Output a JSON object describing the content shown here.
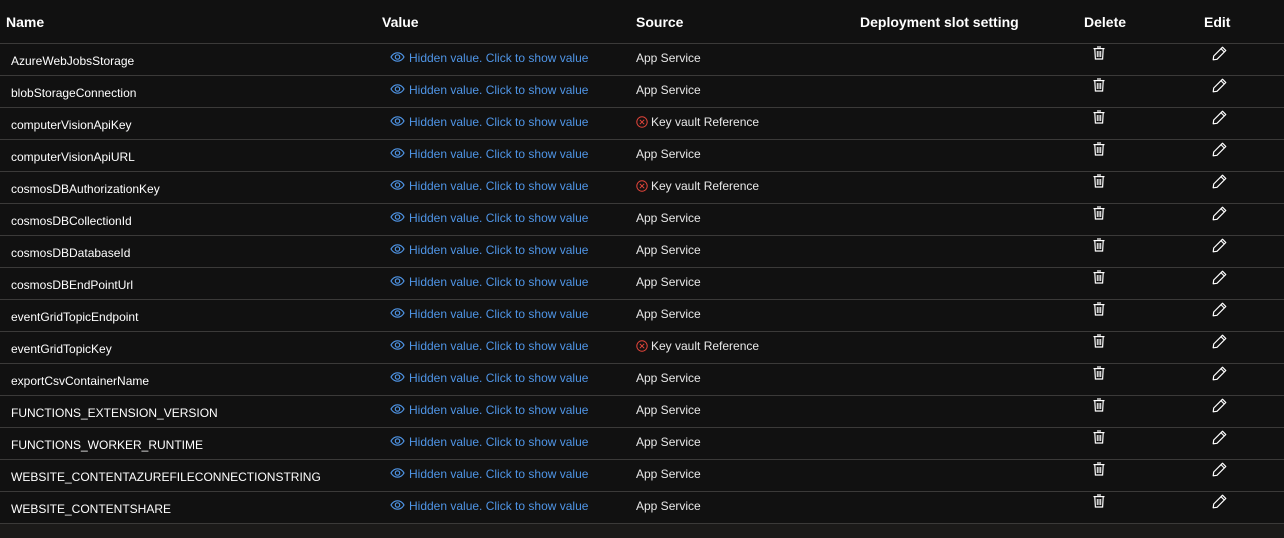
{
  "columns": {
    "name": "Name",
    "value": "Value",
    "source": "Source",
    "slot": "Deployment slot setting",
    "delete": "Delete",
    "edit": "Edit"
  },
  "rows": [
    {
      "name": "AzureWebJobsStorage",
      "value": "Hidden value. Click to show value",
      "source": "App Service",
      "source_error": false
    },
    {
      "name": "blobStorageConnection",
      "value": "Hidden value. Click to show value",
      "source": "App Service",
      "source_error": false
    },
    {
      "name": "computerVisionApiKey",
      "value": "Hidden value. Click to show value",
      "source": "Key vault Reference",
      "source_error": true
    },
    {
      "name": "computerVisionApiURL",
      "value": "Hidden value. Click to show value",
      "source": "App Service",
      "source_error": false
    },
    {
      "name": "cosmosDBAuthorizationKey",
      "value": "Hidden value. Click to show value",
      "source": "Key vault Reference",
      "source_error": true
    },
    {
      "name": "cosmosDBCollectionId",
      "value": "Hidden value. Click to show value",
      "source": "App Service",
      "source_error": false
    },
    {
      "name": "cosmosDBDatabaseId",
      "value": "Hidden value. Click to show value",
      "source": "App Service",
      "source_error": false
    },
    {
      "name": "cosmosDBEndPointUrl",
      "value": "Hidden value. Click to show value",
      "source": "App Service",
      "source_error": false
    },
    {
      "name": "eventGridTopicEndpoint",
      "value": "Hidden value. Click to show value",
      "source": "App Service",
      "source_error": false
    },
    {
      "name": "eventGridTopicKey",
      "value": "Hidden value. Click to show value",
      "source": "Key vault Reference",
      "source_error": true
    },
    {
      "name": "exportCsvContainerName",
      "value": "Hidden value. Click to show value",
      "source": "App Service",
      "source_error": false
    },
    {
      "name": "FUNCTIONS_EXTENSION_VERSION",
      "value": "Hidden value. Click to show value",
      "source": "App Service",
      "source_error": false
    },
    {
      "name": "FUNCTIONS_WORKER_RUNTIME",
      "value": "Hidden value. Click to show value",
      "source": "App Service",
      "source_error": false
    },
    {
      "name": "WEBSITE_CONTENTAZUREFILECONNECTIONSTRING",
      "value": "Hidden value. Click to show value",
      "source": "App Service",
      "source_error": false
    },
    {
      "name": "WEBSITE_CONTENTSHARE",
      "value": "Hidden value. Click to show value",
      "source": "App Service",
      "source_error": false
    }
  ],
  "icons": {
    "value": "eye-icon",
    "source_error": "error-circle-icon",
    "delete": "trash-icon",
    "edit": "pencil-icon"
  },
  "colors": {
    "background": "#111111",
    "link": "#4f95e6",
    "error": "#e0443a",
    "divider": "#3b3a39",
    "text": "#ffffff"
  }
}
